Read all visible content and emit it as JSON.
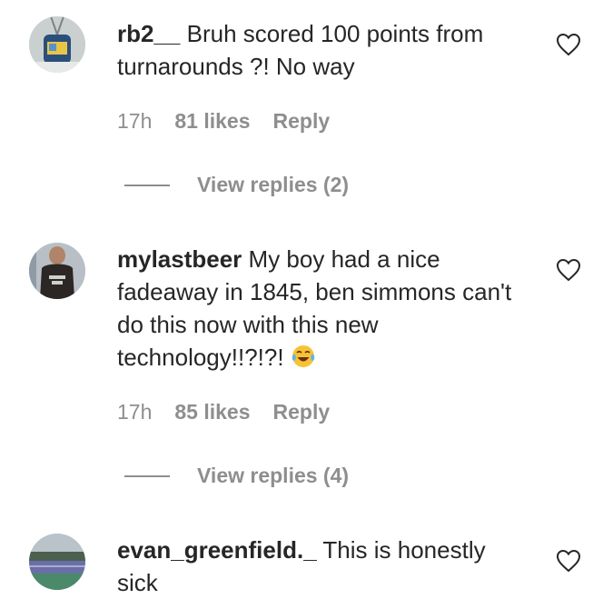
{
  "comments": [
    {
      "username": "rb2__",
      "text": "Bruh scored 100 points from turnarounds ?! No way",
      "time": "17h",
      "likes": "81 likes",
      "reply": "Reply",
      "view_replies": "View replies (2)"
    },
    {
      "username": "mylastbeer",
      "text": "My boy had a nice fadeaway in 1845, ben simmons can't do this now with this new technology!!?!?!",
      "emoji": "face-with-tears-of-joy",
      "time": "17h",
      "likes": "85 likes",
      "reply": "Reply",
      "view_replies": "View replies (4)"
    },
    {
      "username": "evan_greenfield._",
      "text": "This is honestly sick"
    }
  ]
}
